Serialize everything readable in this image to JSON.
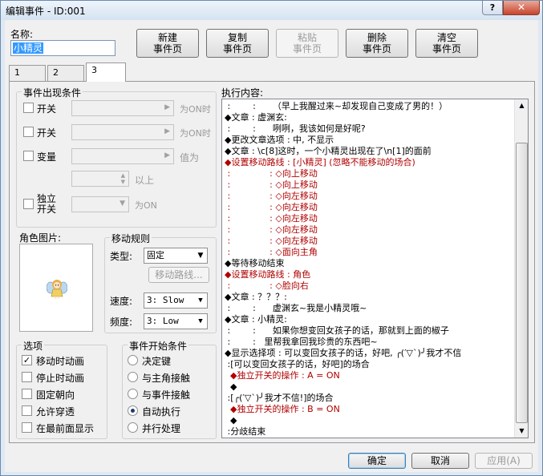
{
  "window": {
    "title": "编辑事件 - ID:001",
    "help": "?",
    "close": "✕"
  },
  "name_label": "名称:",
  "name_value": "小精灵",
  "toolbar": {
    "new": [
      "新建",
      "事件页"
    ],
    "copy": [
      "复制",
      "事件页"
    ],
    "paste": [
      "粘贴",
      "事件页"
    ],
    "delete": [
      "删除",
      "事件页"
    ],
    "clear": [
      "清空",
      "事件页"
    ]
  },
  "tabs": [
    "1",
    "2",
    "3"
  ],
  "conditions": {
    "title": "事件出现条件",
    "switch1": "开关",
    "switch1_suffix": "为ON时",
    "switch2": "开关",
    "switch2_suffix": "为ON时",
    "variable": "变量",
    "variable_suffix": "值为",
    "above": "以上",
    "self_switch": [
      "独立",
      "开关"
    ],
    "self_suffix": "为ON"
  },
  "graphic_label": "角色图片:",
  "movement": {
    "title": "移动规则",
    "type_label": "类型:",
    "type_value": "固定",
    "route_button": "移动路线...",
    "speed_label": "速度:",
    "speed_value": "3: Slow",
    "freq_label": "频度:",
    "freq_value": "3: Low"
  },
  "options": {
    "title": "选项",
    "items": [
      {
        "label": "移动时动画",
        "checked": "✓"
      },
      {
        "label": "停止时动画",
        "checked": ""
      },
      {
        "label": "固定朝向",
        "checked": ""
      },
      {
        "label": "允许穿透",
        "checked": ""
      },
      {
        "label": "在最前面显示",
        "checked": ""
      }
    ]
  },
  "trigger": {
    "title": "事件开始条件",
    "items": [
      {
        "label": "决定键",
        "selected": false
      },
      {
        "label": "与主角接触",
        "selected": false
      },
      {
        "label": "与事件接触",
        "selected": false
      },
      {
        "label": "自动执行",
        "selected": true
      },
      {
        "label": "并行处理",
        "selected": false
      }
    ]
  },
  "contents_label": "执行内容:",
  "contents": [
    {
      "text": " :        :      （早上我醒过来~却发现自己变成了男的！）",
      "red": false
    },
    {
      "text": "◆文章 : 虚渊玄:",
      "red": false
    },
    {
      "text": " :        :      咧咧，我该如何是好呢?",
      "red": false
    },
    {
      "text": "◆更改文章选项 : 中, 不显示",
      "red": false
    },
    {
      "text": "◆文章 : \\c[8]这时，一个小精灵出现在了\\n[1]的面前",
      "red": false
    },
    {
      "text": "◆设置移动路线 : [小精灵] (忽略不能移动的场合)",
      "red": true
    },
    {
      "text": " :              : ◇向上移动",
      "red": true
    },
    {
      "text": " :              : ◇向上移动",
      "red": true
    },
    {
      "text": " :              : ◇向左移动",
      "red": true
    },
    {
      "text": " :              : ◇向左移动",
      "red": true
    },
    {
      "text": " :              : ◇向左移动",
      "red": true
    },
    {
      "text": " :              : ◇向左移动",
      "red": true
    },
    {
      "text": " :              : ◇向左移动",
      "red": true
    },
    {
      "text": " :              : ◇面向主角",
      "red": true
    },
    {
      "text": "◆等待移动结束",
      "red": false
    },
    {
      "text": "◆设置移动路线 : 角色",
      "red": true
    },
    {
      "text": " :              : ◇脸向右",
      "red": true
    },
    {
      "text": "◆文章 : ？？？:",
      "red": false
    },
    {
      "text": " :        :      虚渊玄~我是小精灵哦~",
      "red": false
    },
    {
      "text": "◆文章 : 小精灵:",
      "red": false
    },
    {
      "text": " :        :      如果你想变回女孩子的话，那就到上面的椒子",
      "red": false
    },
    {
      "text": " :        :   里帮我拿回我珍贵的东西吧~",
      "red": false
    },
    {
      "text": "◆显示选择项 : 可以变回女孩子的话，好吧, ╭(′▽`)╯我才不信",
      "red": false
    },
    {
      "text": " :[可以变回女孩子的话，好吧]的场合",
      "red": false
    },
    {
      "text": "  ◆独立开关的操作 : A = ON",
      "red": true
    },
    {
      "text": "  ◆",
      "red": false
    },
    {
      "text": " :[╭(′▽`)╯我才不信!]的场合",
      "red": false
    },
    {
      "text": "  ◆独立开关的操作 : B = ON",
      "red": true
    },
    {
      "text": "  ◆",
      "red": false
    },
    {
      "text": " :分歧结束",
      "red": false
    },
    {
      "text": "◆",
      "red": false
    }
  ],
  "footer": {
    "ok": "确定",
    "cancel": "取消",
    "apply": "应用(A)"
  },
  "colors": {
    "accent": "#3399ff",
    "command_red": "#b00000"
  }
}
